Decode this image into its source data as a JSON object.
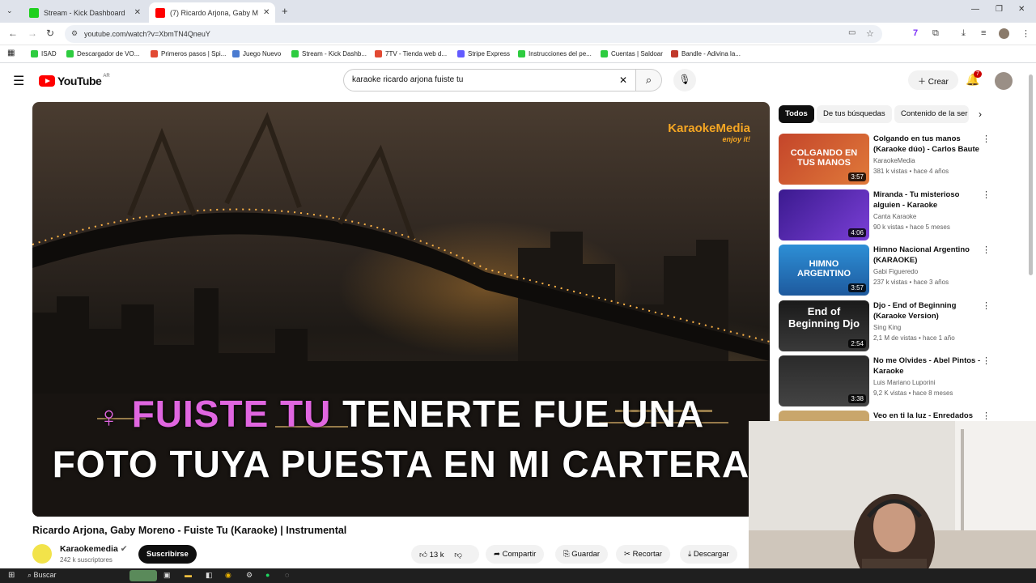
{
  "browser": {
    "tabs": [
      {
        "title": "Stream - Kick Dashboard",
        "favicon_color": "#1fd01f"
      },
      {
        "title": "(7) Ricardo Arjona, Gaby M",
        "favicon_color": "#ff0000"
      }
    ],
    "new_tab": "+",
    "url": "youtube.com/watch?v=XbmTN4QneuY",
    "bookmarks": [
      {
        "label": "ISAD",
        "color": "#2ecc40"
      },
      {
        "label": "Descargador de VO...",
        "color": "#2ecc40"
      },
      {
        "label": "Primeros pasos | Spi...",
        "color": "#e24a33"
      },
      {
        "label": "Juego Nuevo",
        "color": "#4a7bd0"
      },
      {
        "label": "Stream - Kick Dashb...",
        "color": "#2ecc40"
      },
      {
        "label": "7TV - Tienda web d...",
        "color": "#e24a33"
      },
      {
        "label": "Stripe Express",
        "color": "#635bff"
      },
      {
        "label": "Instrucciones del pe...",
        "color": "#2ecc40"
      },
      {
        "label": "Cuentas | Saldoar",
        "color": "#2ecc40"
      },
      {
        "label": "Bandle - Adivina la...",
        "color": "#c0392b"
      }
    ]
  },
  "youtube": {
    "logo_text": "YouTube",
    "logo_region": "AR",
    "search_query": "karaoke ricardo arjona fuiste tu",
    "create_label": "Crear",
    "notif_count": "7"
  },
  "video": {
    "watermark": "KaraokeMedia",
    "watermark_sub": "enjoy it!",
    "lyric1_highlight": "FUISTE TU",
    "lyric1_rest": "TENERTE FUE UNA",
    "lyric2": "FOTO TUYA PUESTA EN MI CARTERA",
    "title": "Ricardo Arjona, Gaby Moreno - Fuiste Tu (Karaoke) | Instrumental",
    "channel": "Karaokemedia",
    "subscribers": "242 k suscriptores",
    "subscribe_label": "Suscribirse",
    "likes": "13 k",
    "share_label": "Compartir",
    "save_label": "Guardar",
    "clip_label": "Recortar",
    "download_label": "Descargar"
  },
  "sidebar": {
    "chips": [
      "Todos",
      "De tus búsquedas",
      "Contenido de la ser"
    ],
    "recs": [
      {
        "title": "Colgando en tus manos (Karaoke dúo) - Carlos Baute ...",
        "channel": "KaraokeMedia",
        "meta": "381 k vistas • hace 4 años",
        "duration": "3:57",
        "thumb_text": "COLGANDO EN TUS MANOS",
        "thumb_color": "#c4452a"
      },
      {
        "title": "Miranda - Tu misterioso alguien - Karaoke",
        "channel": "Canta Karaoke",
        "meta": "90 k vistas • hace 5 meses",
        "duration": "4:06",
        "thumb_text": "",
        "thumb_color": "#5b2bb3"
      },
      {
        "title": "Himno Nacional Argentino (KARAOKE)",
        "channel": "Gabi Figueredo",
        "meta": "237 k vistas • hace 3 años",
        "duration": "3:57",
        "thumb_text": "HIMNO ARGENTINO",
        "thumb_color": "#1e6fb5"
      },
      {
        "title": "Djo - End of Beginning (Karaoke Version)",
        "channel": "Sing King",
        "meta": "2,1 M de vistas • hace 1 año",
        "duration": "2:54",
        "thumb_text": "End of Beginning Djo",
        "thumb_color": "#2a2a2a"
      },
      {
        "title": "No me Olvides - Abel Pintos - Karaoke",
        "channel": "Luis Mariano Luporini",
        "meta": "9,2 K vistas • hace 8 meses",
        "duration": "3:38",
        "thumb_text": "",
        "thumb_color": "#3a3a3a"
      },
      {
        "title": "Veo en ti la luz - Enredados",
        "channel": "",
        "meta": "",
        "duration": "",
        "thumb_text": "",
        "thumb_color": "#c9a66b"
      }
    ]
  },
  "taskbar": {
    "search_label": "Buscar"
  }
}
